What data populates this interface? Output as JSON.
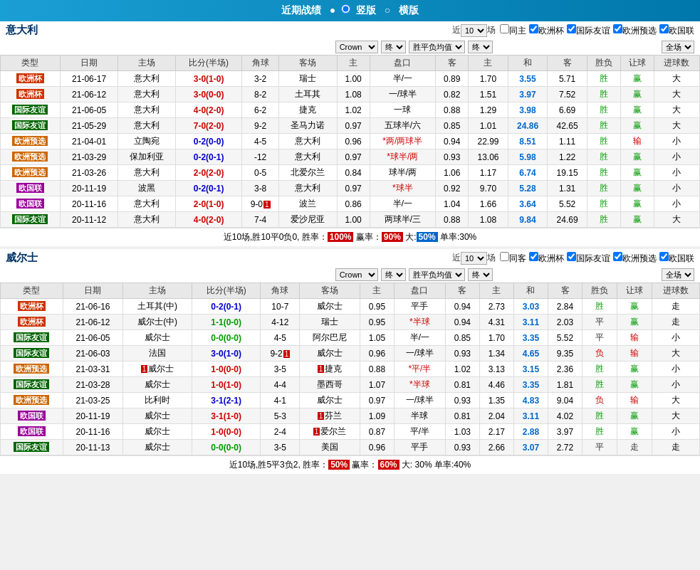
{
  "topBar": {
    "title": "近期战绩",
    "separator": "●",
    "option1": "竖版",
    "option2": "横版"
  },
  "section1": {
    "name": "意大利",
    "filter": {
      "prefix": "近",
      "count": "10",
      "suffix": "场",
      "options": [
        "同主",
        "欧洲杯",
        "国际友谊",
        "欧洲预选",
        "欧国联"
      ],
      "checkboxLabels": [
        "同主",
        "欧洲杯",
        "国际友谊",
        "欧洲预选",
        "欧国联"
      ]
    },
    "controls": {
      "crown": "Crown",
      "end1": "终",
      "avgLabel": "胜平负均值",
      "end2": "终",
      "allLabel": "全场"
    },
    "headers": [
      "类型",
      "日期",
      "主场",
      "比分(半场)",
      "角球",
      "客场",
      "主",
      "盘口",
      "客",
      "主",
      "和",
      "客",
      "胜负",
      "让球",
      "进球数"
    ],
    "rows": [
      {
        "type": "欧洲杯",
        "typeClass": "type-euro",
        "date": "21-06-17",
        "home": "意大利",
        "score": "3-0(1-0)",
        "scoreClass": "score-red",
        "corners": "3-2",
        "away": "瑞士",
        "m1": "1.00",
        "handicap": "半/一",
        "m2": "0.89",
        "a1": "1.70",
        "a2": "3.55",
        "a3": "5.71",
        "result": "胜",
        "resultClass": "result-win",
        "rb": "赢",
        "rbClass": "result-win",
        "size": "大"
      },
      {
        "type": "欧洲杯",
        "typeClass": "type-euro",
        "date": "21-06-12",
        "home": "意大利",
        "score": "3-0(0-0)",
        "scoreClass": "score-red",
        "corners": "8-2",
        "away": "土耳其",
        "m1": "1.08",
        "handicap": "一/球半",
        "m2": "0.82",
        "a1": "1.51",
        "a2": "3.97",
        "a3": "7.52",
        "result": "胜",
        "resultClass": "result-win",
        "rb": "赢",
        "rbClass": "result-win",
        "size": "大"
      },
      {
        "type": "国际友谊",
        "typeClass": "type-intl",
        "date": "21-06-05",
        "home": "意大利",
        "score": "4-0(2-0)",
        "scoreClass": "score-red",
        "corners": "6-2",
        "away": "捷克",
        "m1": "1.02",
        "handicap": "一球",
        "m2": "0.88",
        "a1": "1.29",
        "a2": "3.98",
        "a3": "6.69",
        "result": "胜",
        "resultClass": "result-win",
        "rb": "赢",
        "rbClass": "result-win",
        "size": "大"
      },
      {
        "type": "国际友谊",
        "typeClass": "type-intl",
        "date": "21-05-29",
        "home": "意大利",
        "score": "7-0(2-0)",
        "scoreClass": "score-red",
        "corners": "9-2",
        "away": "圣马力诺",
        "m1": "0.97",
        "handicap": "五球半/六",
        "m2": "0.85",
        "a1": "1.01",
        "a2": "24.86",
        "a3": "42.65",
        "result": "胜",
        "resultClass": "result-win",
        "rb": "赢",
        "rbClass": "result-win",
        "size": "大"
      },
      {
        "type": "欧洲预选",
        "typeClass": "type-qualifier",
        "date": "21-04-01",
        "home": "立陶宛",
        "score": "0-2(0-0)",
        "scoreClass": "score-blue",
        "corners": "4-5",
        "away": "意大利",
        "m1": "0.96",
        "handicap": "*两/两球半",
        "handicapClass": "note-red",
        "m2": "0.94",
        "a1": "22.99",
        "a2": "8.51",
        "a3": "1.11",
        "result": "胜",
        "resultClass": "result-win",
        "rb": "输",
        "rbClass": "result-lose",
        "size": "小"
      },
      {
        "type": "欧洲预选",
        "typeClass": "type-qualifier",
        "date": "21-03-29",
        "home": "保加利亚",
        "score": "0-2(0-1)",
        "scoreClass": "score-blue",
        "corners": "-12",
        "away": "意大利",
        "m1": "0.97",
        "handicap": "*球半/两",
        "handicapClass": "note-red",
        "m2": "0.93",
        "a1": "13.06",
        "a2": "5.98",
        "a3": "1.22",
        "result": "胜",
        "resultClass": "result-win",
        "rb": "赢",
        "rbClass": "result-win",
        "size": "小"
      },
      {
        "type": "欧洲预选",
        "typeClass": "type-qualifier",
        "date": "21-03-26",
        "home": "意大利",
        "score": "2-0(2-0)",
        "scoreClass": "score-red",
        "corners": "0-5",
        "away": "北爱尔兰",
        "m1": "0.84",
        "handicap": "球半/两",
        "m2": "1.06",
        "a1": "1.17",
        "a2": "6.74",
        "a3": "19.15",
        "result": "胜",
        "resultClass": "result-win",
        "rb": "赢",
        "rbClass": "result-win",
        "size": "小"
      },
      {
        "type": "欧国联",
        "typeClass": "type-nations",
        "date": "20-11-19",
        "home": "波黑",
        "score": "0-2(0-1)",
        "scoreClass": "score-blue",
        "corners": "3-8",
        "away": "意大利",
        "m1": "0.97",
        "handicap": "*球半",
        "handicapClass": "note-red",
        "m2": "0.92",
        "a1": "9.70",
        "a2": "5.28",
        "a3": "1.31",
        "result": "胜",
        "resultClass": "result-win",
        "rb": "赢",
        "rbClass": "result-win",
        "size": "小"
      },
      {
        "type": "欧国联",
        "typeClass": "type-nations",
        "date": "20-11-16",
        "home": "意大利",
        "score": "2-0(1-0)",
        "scoreClass": "score-red",
        "corners": "9-0",
        "away": "波兰",
        "cornerNote": "1",
        "m1": "0.86",
        "handicap": "半/一",
        "m2": "1.04",
        "a1": "1.66",
        "a2": "3.64",
        "a3": "5.52",
        "result": "胜",
        "resultClass": "result-win",
        "rb": "赢",
        "rbClass": "result-win",
        "size": "小"
      },
      {
        "type": "国际友谊",
        "typeClass": "type-intl",
        "date": "20-11-12",
        "home": "意大利",
        "score": "4-0(2-0)",
        "scoreClass": "score-red",
        "corners": "7-4",
        "away": "爱沙尼亚",
        "m1": "1.00",
        "handicap": "两球半/三",
        "m2": "0.88",
        "a1": "1.08",
        "a2": "9.84",
        "a3": "24.69",
        "result": "胜",
        "resultClass": "result-win",
        "rb": "赢",
        "rbClass": "result-win",
        "size": "大"
      }
    ],
    "statLine": "近10场,胜10平0负0, 胜率：100% 赢率：90% 大:50% 单率:30%"
  },
  "section2": {
    "name": "威尔士",
    "filter": {
      "prefix": "近",
      "count": "10",
      "suffix": "场"
    },
    "controls": {
      "crown": "Crown",
      "end1": "终",
      "avgLabel": "胜平负均值",
      "end2": "终",
      "allLabel": "全场"
    },
    "headers": [
      "类型",
      "日期",
      "主场",
      "比分(半场)",
      "角球",
      "客场",
      "主",
      "盘口",
      "客",
      "主",
      "和",
      "客",
      "胜负",
      "让球",
      "进球数"
    ],
    "rows": [
      {
        "type": "欧洲杯",
        "typeClass": "type-euro",
        "date": "21-06-16",
        "home": "土耳其(中)",
        "score": "0-2(0-1)",
        "scoreClass": "score-blue",
        "corners": "10-7",
        "away": "威尔士",
        "m1": "0.95",
        "handicap": "平手",
        "m2": "0.94",
        "a1": "2.73",
        "a2": "3.03",
        "a3": "2.84",
        "result": "胜",
        "resultClass": "result-win",
        "rb": "赢",
        "rbClass": "result-win",
        "size": "走"
      },
      {
        "type": "欧洲杯",
        "typeClass": "type-euro",
        "date": "21-06-12",
        "home": "威尔士(中)",
        "score": "1-1(0-0)",
        "scoreClass": "score-green",
        "corners": "4-12",
        "away": "瑞士",
        "m1": "0.95",
        "handicap": "*半球",
        "handicapClass": "note-red",
        "m2": "0.94",
        "a1": "4.31",
        "a2": "3.11",
        "a3": "2.03",
        "result": "平",
        "resultClass": "result-draw",
        "rb": "赢",
        "rbClass": "result-win",
        "size": "走"
      },
      {
        "type": "国际友谊",
        "typeClass": "type-intl",
        "date": "21-06-05",
        "home": "威尔士",
        "score": "0-0(0-0)",
        "scoreClass": "score-green",
        "corners": "4-5",
        "away": "阿尔巴尼",
        "m1": "1.05",
        "handicap": "半/一",
        "m2": "0.85",
        "a1": "1.70",
        "a2": "3.35",
        "a3": "5.52",
        "result": "平",
        "resultClass": "result-draw",
        "rb": "输",
        "rbClass": "result-lose",
        "size": "小"
      },
      {
        "type": "国际友谊",
        "typeClass": "type-intl",
        "date": "21-06-03",
        "home": "法国",
        "score": "3-0(1-0)",
        "scoreClass": "score-blue",
        "corners": "9-2",
        "away": "威尔士",
        "cornerNote": "1",
        "m1": "0.96",
        "handicap": "一/球半",
        "m2": "0.93",
        "a1": "1.34",
        "a2": "4.65",
        "a3": "9.35",
        "result": "负",
        "resultClass": "result-lose",
        "rb": "输",
        "rbClass": "result-lose",
        "size": "大"
      },
      {
        "type": "欧洲预选",
        "typeClass": "type-qualifier",
        "date": "21-03-31",
        "home": "威尔士",
        "homeNote": "1",
        "score": "1-0(0-0)",
        "scoreClass": "score-red",
        "corners": "3-5",
        "away": "捷克",
        "awayNote": "1",
        "m1": "0.88",
        "handicap": "*平/半",
        "handicapClass": "note-red",
        "m2": "1.02",
        "a1": "3.13",
        "a2": "3.15",
        "a3": "2.36",
        "result": "胜",
        "resultClass": "result-win",
        "rb": "赢",
        "rbClass": "result-win",
        "size": "小"
      },
      {
        "type": "国际友谊",
        "typeClass": "type-intl",
        "date": "21-03-28",
        "home": "威尔士",
        "score": "1-0(1-0)",
        "scoreClass": "score-red",
        "corners": "4-4",
        "away": "墨西哥",
        "m1": "1.07",
        "handicap": "*半球",
        "handicapClass": "note-red",
        "m2": "0.81",
        "a1": "4.46",
        "a2": "3.35",
        "a3": "1.81",
        "result": "胜",
        "resultClass": "result-win",
        "rb": "赢",
        "rbClass": "result-win",
        "size": "小"
      },
      {
        "type": "欧洲预选",
        "typeClass": "type-qualifier",
        "date": "21-03-25",
        "home": "比利时",
        "score": "3-1(2-1)",
        "scoreClass": "score-blue",
        "corners": "4-1",
        "away": "威尔士",
        "m1": "0.97",
        "handicap": "一/球半",
        "m2": "0.93",
        "a1": "1.35",
        "a2": "4.83",
        "a3": "9.04",
        "result": "负",
        "resultClass": "result-lose",
        "rb": "输",
        "rbClass": "result-lose",
        "size": "大"
      },
      {
        "type": "欧国联",
        "typeClass": "type-nations",
        "date": "20-11-19",
        "home": "威尔士",
        "score": "3-1(1-0)",
        "scoreClass": "score-red",
        "corners": "5-3",
        "away": "芬兰",
        "awayNote": "1",
        "m1": "1.09",
        "handicap": "半球",
        "m2": "0.81",
        "a1": "2.04",
        "a2": "3.11",
        "a3": "4.02",
        "result": "胜",
        "resultClass": "result-win",
        "rb": "赢",
        "rbClass": "result-win",
        "size": "大"
      },
      {
        "type": "欧国联",
        "typeClass": "type-nations",
        "date": "20-11-16",
        "home": "威尔士",
        "score": "1-0(0-0)",
        "scoreClass": "score-red",
        "corners": "2-4",
        "away": "爱尔兰",
        "awayNote": "1",
        "m1": "0.87",
        "handicap": "平/半",
        "m2": "1.03",
        "a1": "2.17",
        "a2": "2.88",
        "a3": "3.97",
        "result": "胜",
        "resultClass": "result-win",
        "rb": "赢",
        "rbClass": "result-win",
        "size": "小"
      },
      {
        "type": "国际友谊",
        "typeClass": "type-intl",
        "date": "20-11-13",
        "home": "威尔士",
        "score": "0-0(0-0)",
        "scoreClass": "score-green",
        "corners": "3-5",
        "away": "美国",
        "m1": "0.96",
        "handicap": "平手",
        "m2": "0.93",
        "a1": "2.66",
        "a2": "3.07",
        "a3": "2.72",
        "result": "平",
        "resultClass": "result-draw",
        "rb": "走",
        "rbClass": "result-draw",
        "size": "走"
      }
    ],
    "statLine": "近10场,胜5平3负2, 胜率：50% 赢率：60% 大: 30% 单率:40%"
  }
}
